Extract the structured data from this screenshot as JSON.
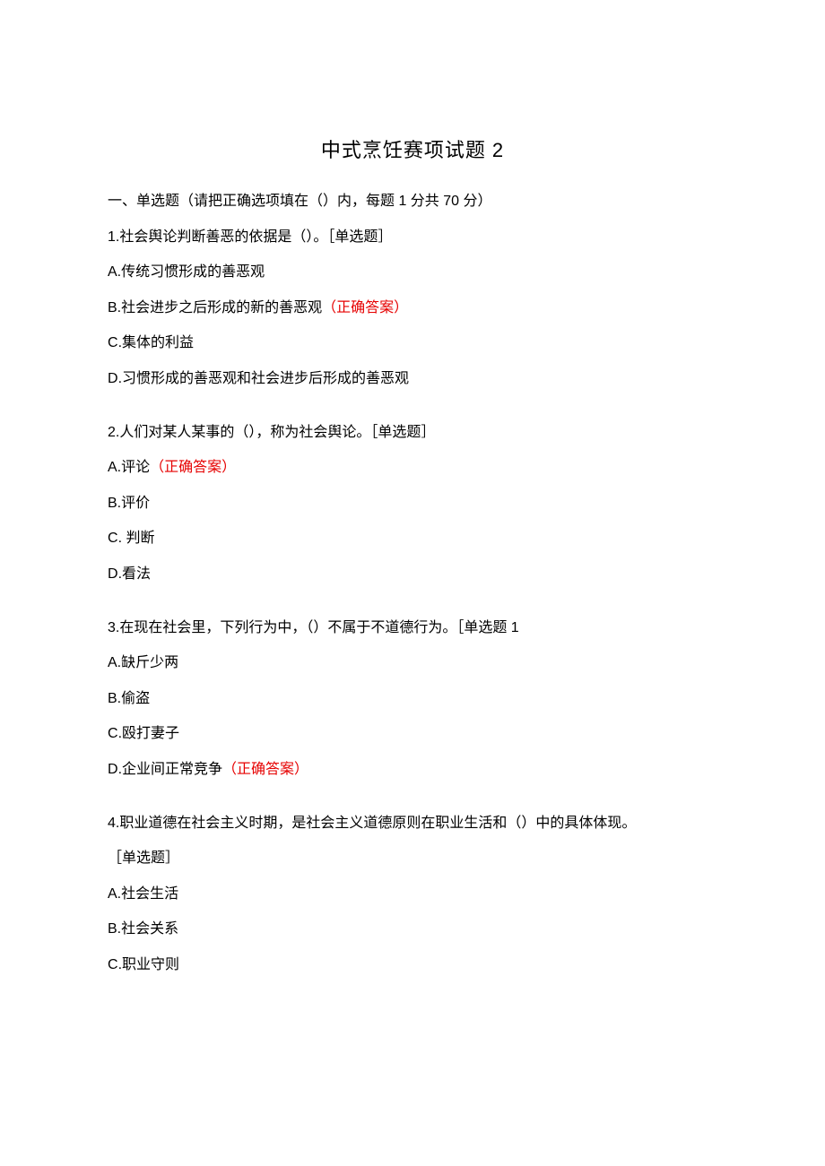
{
  "title": "中式烹饪赛项试题 2",
  "section_header": "一、单选题（请把正确选项填在（）内，每题 1 分共 70 分）",
  "questions": [
    {
      "number": "1",
      "stem": ".社会舆论判断善恶的依据是（）。［单选题］",
      "options": [
        {
          "label": "A",
          "text": ".传统习惯形成的善恶观",
          "correct": false
        },
        {
          "label": "B",
          "text": ".社会进步之后形成的新的善恶观",
          "correct": true
        },
        {
          "label": "C",
          "text": ".集体的利益",
          "correct": false
        },
        {
          "label": "D",
          "text": ".习惯形成的善恶观和社会进步后形成的善恶观",
          "correct": false
        }
      ]
    },
    {
      "number": "2 ",
      "stem": ".人们对某人某事的（），称为社会舆论。［单选题］",
      "options": [
        {
          "label": "A",
          "text": ".评论",
          "correct": true
        },
        {
          "label": "B",
          "text": ".评价",
          "correct": false
        },
        {
          "label": "C",
          "text": ". 判断",
          "correct": false
        },
        {
          "label": "D",
          "text": ".看法",
          "correct": false
        }
      ]
    },
    {
      "number": "3 ",
      "stem": ".在现在社会里，下列行为中，（）不属于不道德行为。［单选题 1",
      "options": [
        {
          "label": "A",
          "text": ".缺斤少两",
          "correct": false
        },
        {
          "label": "B",
          "text": ".偷盗",
          "correct": false
        },
        {
          "label": "C",
          "text": ".殴打妻子",
          "correct": false
        },
        {
          "label": "D",
          "text": ".企业间正常竞争",
          "correct": true
        }
      ]
    },
    {
      "number": "4 ",
      "stem": ".职业道德在社会主义时期，是社会主义道德原则在职业生活和（）中的具体体现。",
      "stem_line2": "［单选题］",
      "options": [
        {
          "label": "A",
          "text": ".社会生活",
          "correct": false
        },
        {
          "label": "B",
          "text": ".社会关系",
          "correct": false
        },
        {
          "label": "C",
          "text": ".职业守则",
          "correct": false
        }
      ]
    }
  ],
  "correct_label": "（正确答案）"
}
